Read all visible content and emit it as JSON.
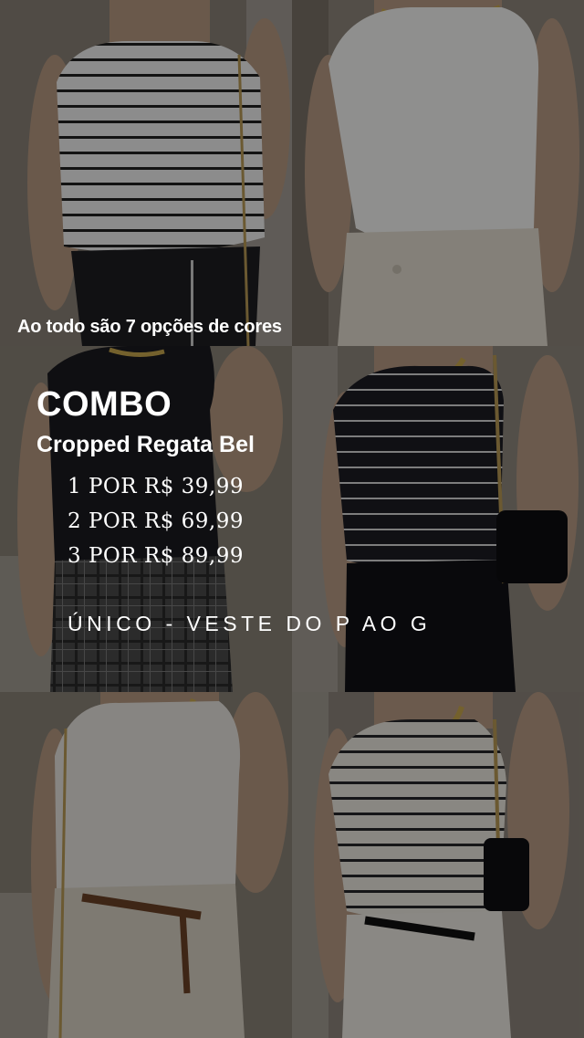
{
  "caption": "Ao todo são 7 opções de cores",
  "promo": {
    "title": "COMBO",
    "product": "Cropped Regata Bel",
    "prices": [
      "1 POR R$ 39,99",
      "2 POR R$ 69,99",
      "3 POR R$ 89,99"
    ],
    "sizing": "ÚNICO - VESTE DO P AO G"
  },
  "photos": [
    {
      "top": "white-black-stripes",
      "bottom": "black-pants"
    },
    {
      "top": "white",
      "bottom": "cream-pants"
    },
    {
      "top": "black",
      "bottom": "plaid-skirt"
    },
    {
      "top": "black-white-stripes",
      "bottom": "black-pants"
    },
    {
      "top": "off-white",
      "bottom": "cream-skirt-brown-belt"
    },
    {
      "top": "cream-black-stripes",
      "bottom": "white-pants"
    }
  ],
  "colors": {
    "text": "#ffffff",
    "overlay": "rgba(0,0,0,0.42)",
    "background": "#1a1918"
  }
}
